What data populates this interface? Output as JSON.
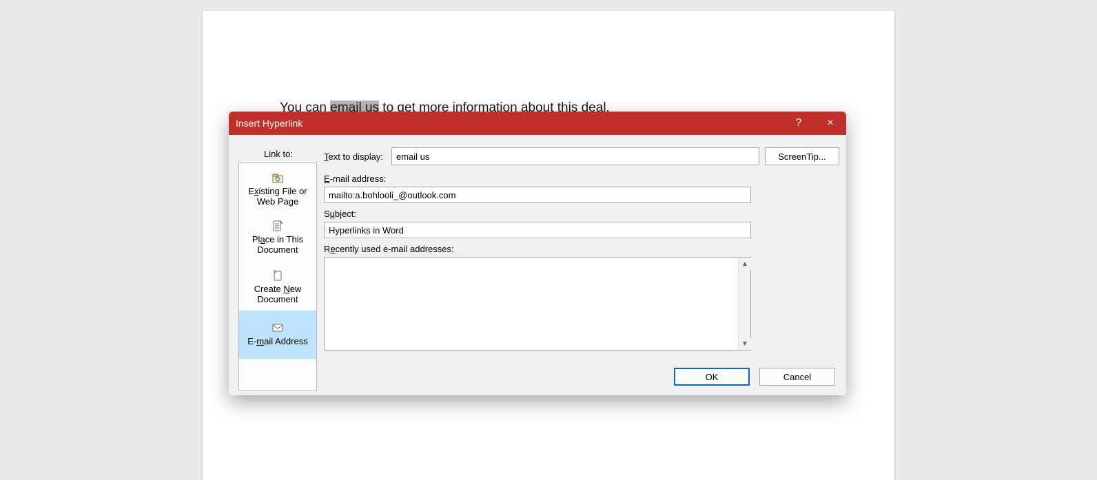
{
  "doc": {
    "text_pre": "You can ",
    "text_sel": "email us",
    "text_post": " to get more information about this deal."
  },
  "dialog": {
    "title": "Insert Hyperlink",
    "help_tooltip": "?",
    "close_tooltip": "×"
  },
  "linkto": {
    "label": "Link to:",
    "existing_pre": "E",
    "existing_x": "x",
    "existing_post": "isting File or Web Page",
    "place_pre": "Pl",
    "place_a": "a",
    "place_post": "ce in This Document",
    "newdoc_pre": "Create ",
    "newdoc_n": "N",
    "newdoc_post": "ew Document",
    "email_pre": "E-",
    "email_m": "m",
    "email_post": "ail Address"
  },
  "form": {
    "text_to_display_pre": "T",
    "text_to_display_post": "ext to display:",
    "text_to_display_value": "email us",
    "screentip_label": "ScreenTip...",
    "email_label_pre": "E",
    "email_label_post": "-mail address:",
    "email_value": "mailto:a.bohlooli_@outlook.com",
    "subject_label_pre": "S",
    "subject_label_u": "u",
    "subject_label_post": "bject:",
    "subject_value": "Hyperlinks in Word",
    "recent_label_pre": "R",
    "recent_label_e": "e",
    "recent_label_post": "cently used e-mail addresses:"
  },
  "buttons": {
    "ok": "OK",
    "cancel": "Cancel"
  }
}
